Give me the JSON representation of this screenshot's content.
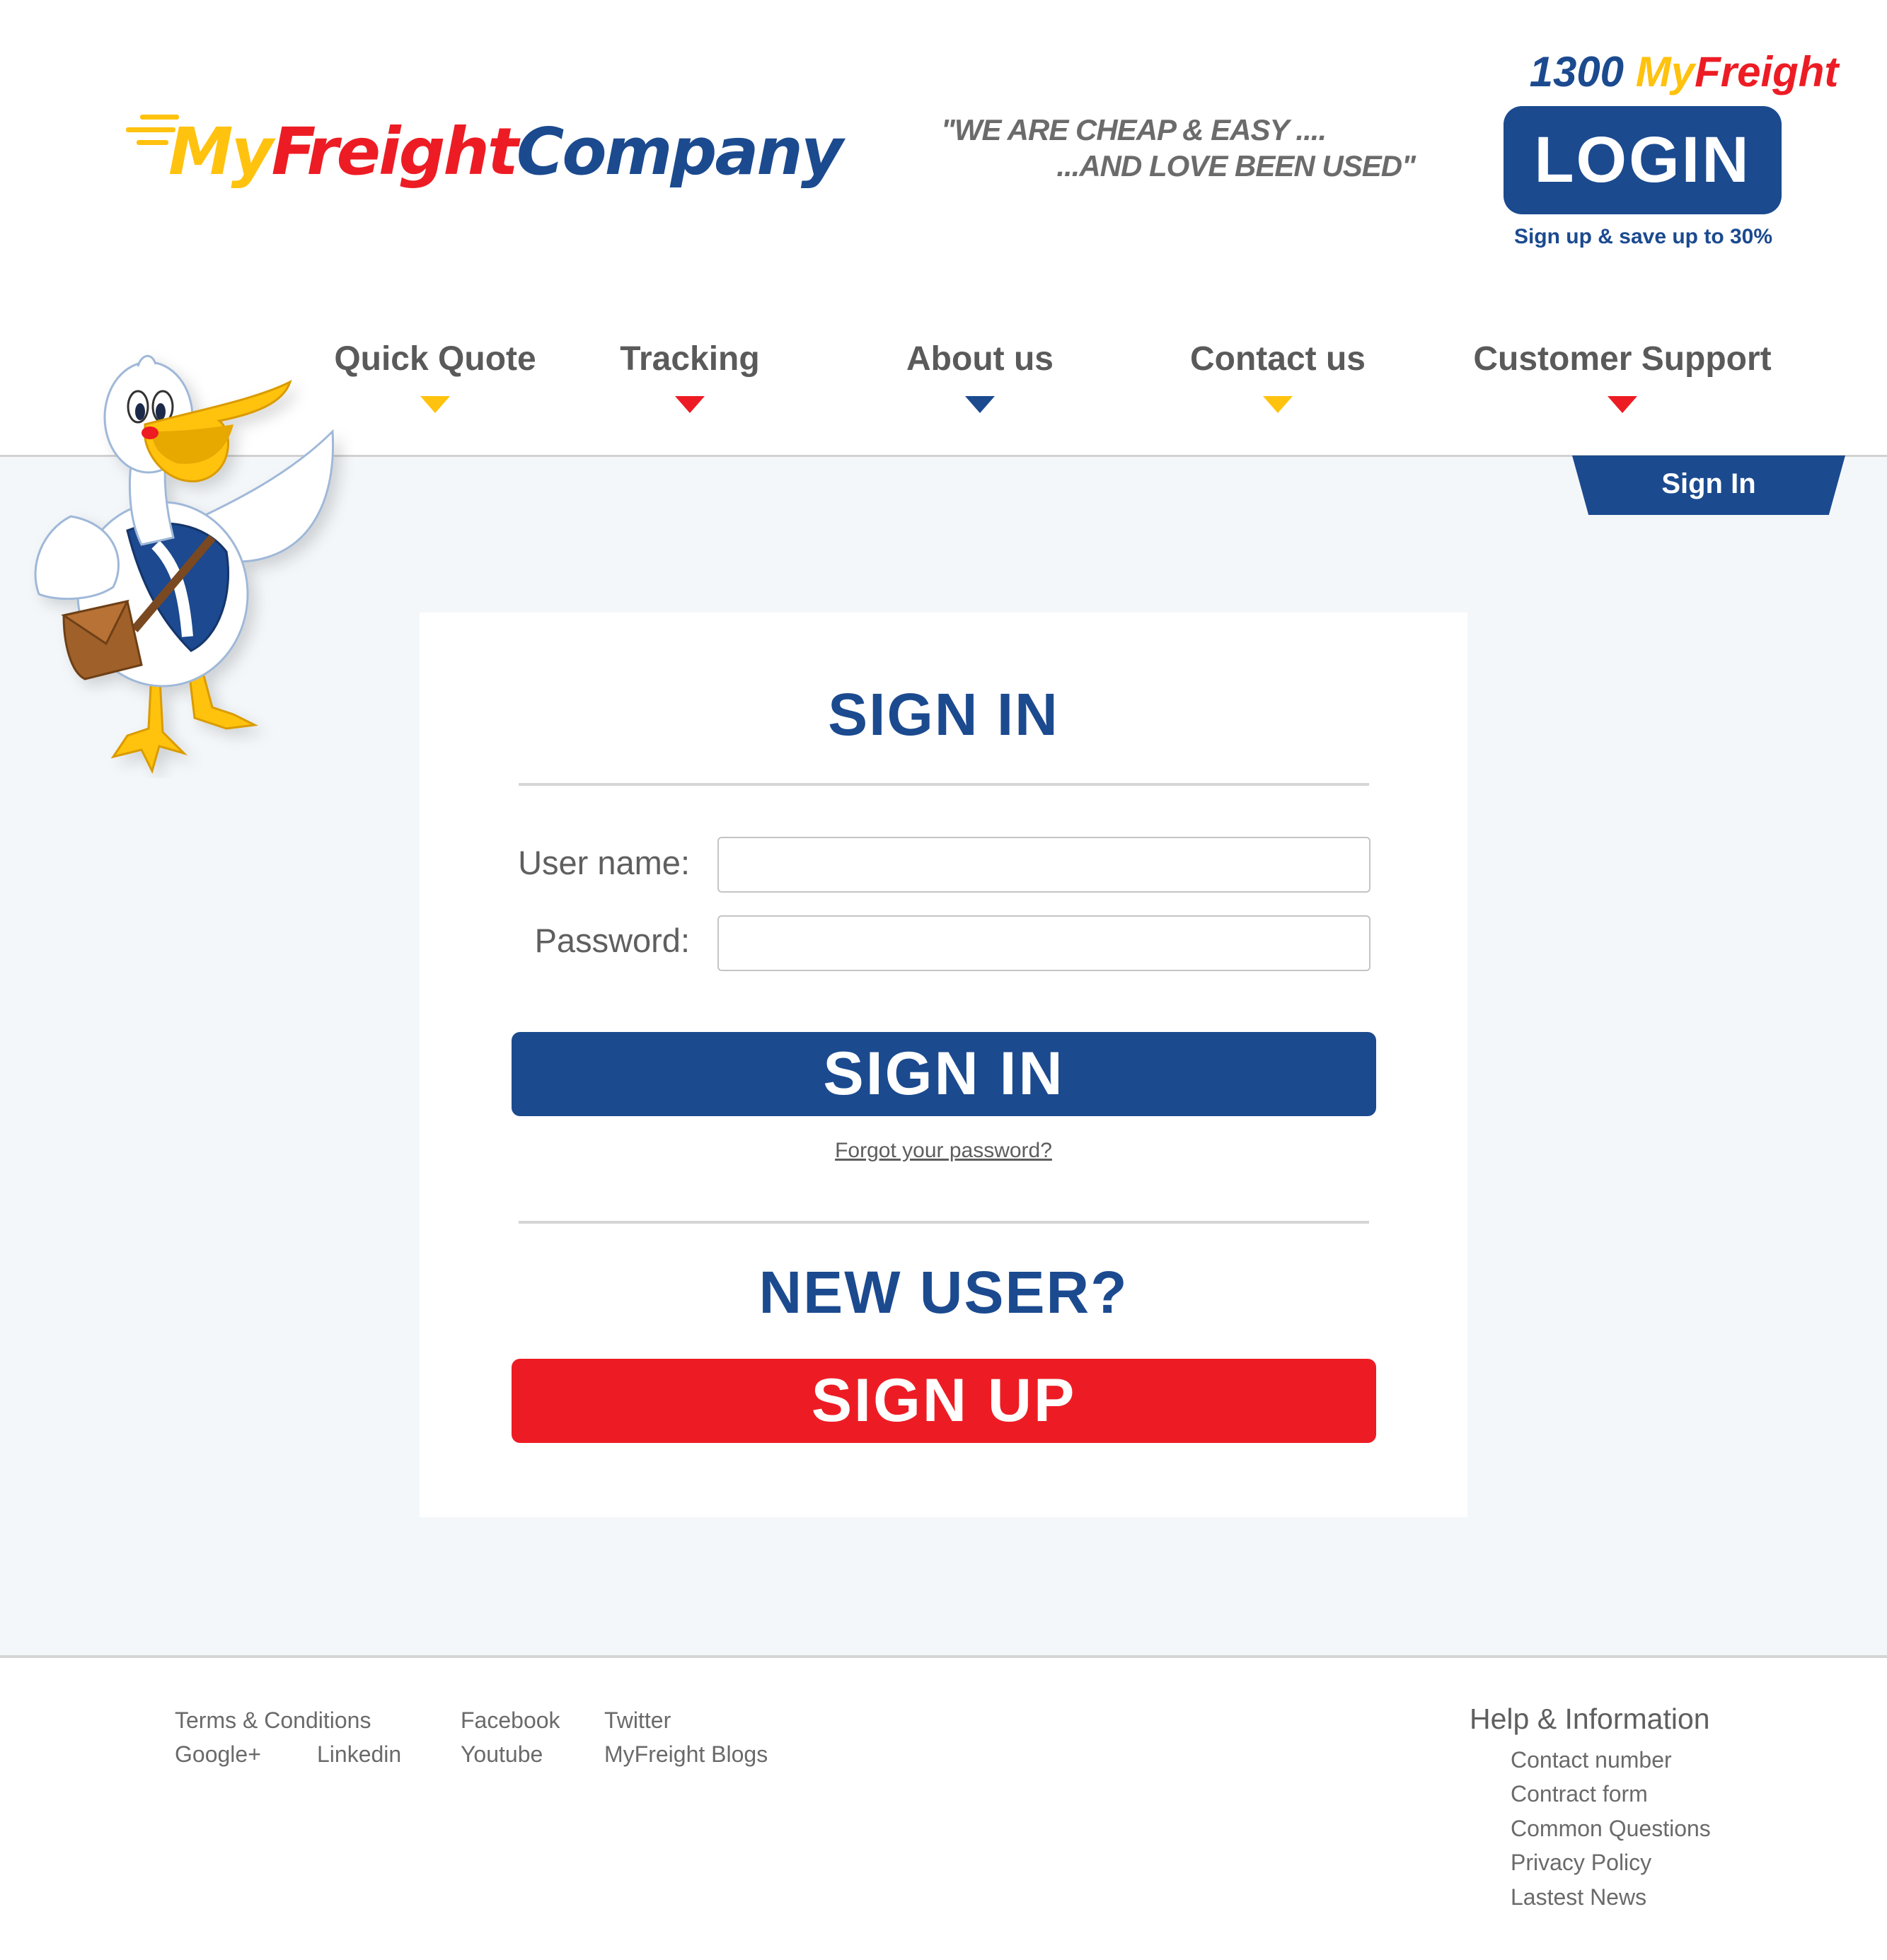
{
  "header": {
    "logo": {
      "my": "My",
      "freight": "Freight",
      "company": "Company"
    },
    "slogan_line1": "\"WE ARE CHEAP & EASY ....",
    "slogan_line2": "...AND LOVE BEEN USED\"",
    "phone": {
      "number": "1300",
      "my": "My",
      "freight": "Freight"
    },
    "login_label": "LOGIN",
    "signup_promo": "Sign up & save up to 30%"
  },
  "nav": [
    {
      "label": "Quick Quote",
      "arrow_color": "yellow"
    },
    {
      "label": "Tracking",
      "arrow_color": "red"
    },
    {
      "label": "About us",
      "arrow_color": "blue"
    },
    {
      "label": "Contact us",
      "arrow_color": "yellow"
    },
    {
      "label": "Customer Support",
      "arrow_color": "red"
    }
  ],
  "signin_tab": "Sign In",
  "form": {
    "heading": "SIGN IN",
    "username_label": "User name:",
    "username_value": "",
    "password_label": "Password:",
    "password_value": "",
    "submit_label": "SIGN IN",
    "forgot_label": "Forgot your password?",
    "new_user_heading": "NEW USER?",
    "signup_label": "SIGN UP"
  },
  "footer": {
    "links": [
      "Terms & Conditions",
      "Facebook",
      "Twitter",
      "Google+",
      "Linkedin",
      "Youtube",
      "MyFreight Blogs"
    ],
    "help_title": "Help & Information",
    "help_links": [
      "Contact number",
      "Contract form",
      "Common Questions",
      "Privacy Policy",
      "Lastest News"
    ]
  },
  "colors": {
    "brand_blue": "#1b4a8f",
    "brand_red": "#ed1c24",
    "brand_yellow": "#ffc20e",
    "page_bg": "#f4f7fa"
  }
}
